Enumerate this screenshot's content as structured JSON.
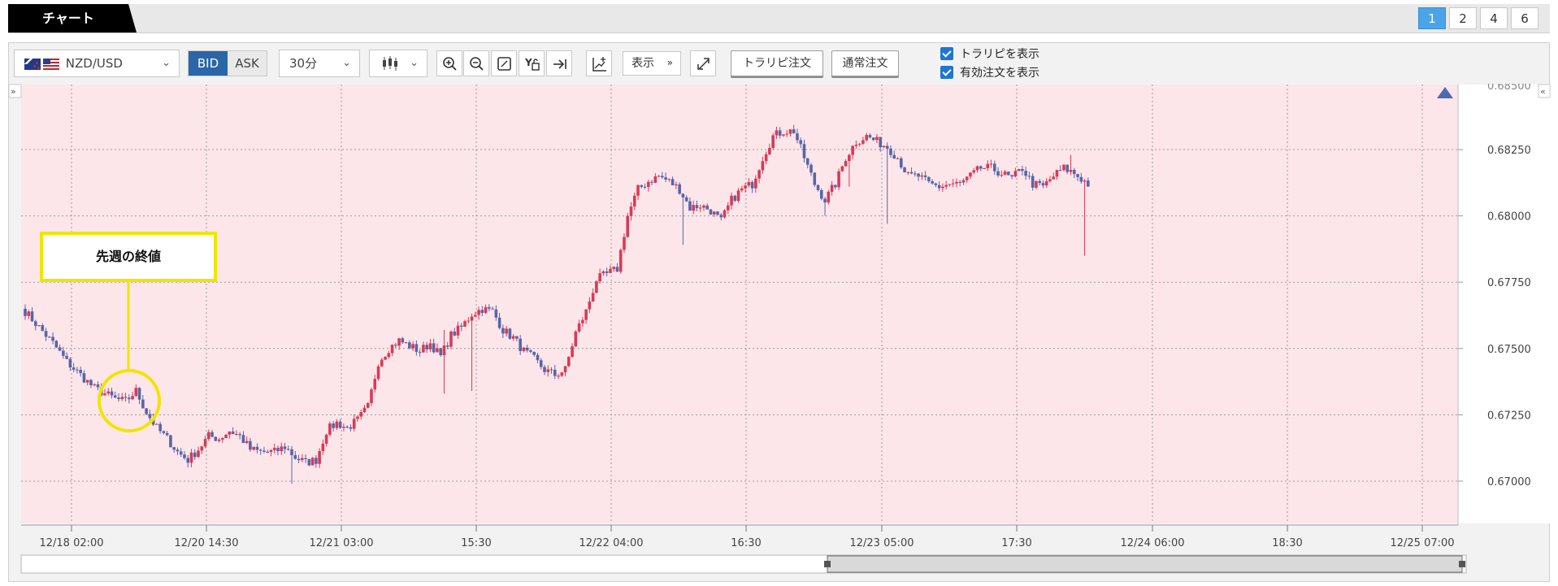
{
  "tab": {
    "title": "チャート"
  },
  "layout_buttons": [
    "1",
    "2",
    "4",
    "6"
  ],
  "toolbar": {
    "symbol": "NZD/USD",
    "bid_label": "BID",
    "ask_label": "ASK",
    "interval": "30分",
    "display_label": "表示",
    "trail_order_label": "トラリピ注文",
    "normal_order_label": "通常注文",
    "checkbox_trail": "トラリピを表示",
    "checkbox_orders": "有効注文を表示"
  },
  "annotation": {
    "label": "先週の終値"
  },
  "colors": {
    "up": "#d83a55",
    "down": "#5865aa",
    "plot_bg": "#fde6ea",
    "annotation": "#f2e400",
    "active": "#4aa4e8"
  },
  "chart_data": {
    "type": "candlestick",
    "symbol": "NZD/USD",
    "interval": "30分",
    "y_ticks": [
      0.67,
      0.6725,
      0.675,
      0.6775,
      0.68,
      0.6825
    ],
    "y_tick_labels": [
      "0.67000",
      "0.67250",
      "0.67500",
      "0.67750",
      "0.68000",
      "0.68250"
    ],
    "x_tick_labels": [
      "12/18 02:00",
      "12/20 14:30",
      "12/21 03:00",
      "15:30",
      "12/22 04:00",
      "16:30",
      "12/23 05:00",
      "17:30",
      "12/24 06:00",
      "18:30",
      "12/25 07:00"
    ],
    "ylim": [
      0.6689,
      0.685
    ],
    "close_keypoints": [
      [
        0,
        0.6764
      ],
      [
        4,
        0.6758
      ],
      [
        8,
        0.6752
      ],
      [
        12,
        0.6745
      ],
      [
        16,
        0.674
      ],
      [
        20,
        0.6735
      ],
      [
        23,
        0.6733
      ],
      [
        26,
        0.6731
      ],
      [
        29,
        0.673
      ],
      [
        32,
        0.6734
      ],
      [
        35,
        0.6726
      ],
      [
        38,
        0.672
      ],
      [
        41,
        0.6716
      ],
      [
        44,
        0.6711
      ],
      [
        47,
        0.6708
      ],
      [
        50,
        0.6712
      ],
      [
        53,
        0.6717
      ],
      [
        56,
        0.6716
      ],
      [
        59,
        0.6719
      ],
      [
        62,
        0.6717
      ],
      [
        65,
        0.6712
      ],
      [
        68,
        0.6711
      ],
      [
        72,
        0.6711
      ],
      [
        75,
        0.6713
      ],
      [
        78,
        0.6709
      ],
      [
        81,
        0.6707
      ],
      [
        84,
        0.6708
      ],
      [
        87,
        0.6719
      ],
      [
        90,
        0.6722
      ],
      [
        93,
        0.672
      ],
      [
        96,
        0.6723
      ],
      [
        99,
        0.6728
      ],
      [
        102,
        0.6745
      ],
      [
        105,
        0.675
      ],
      [
        108,
        0.6753
      ],
      [
        111,
        0.6751
      ],
      [
        114,
        0.6749
      ],
      [
        117,
        0.6752
      ],
      [
        120,
        0.6747
      ],
      [
        123,
        0.6755
      ],
      [
        126,
        0.6758
      ],
      [
        129,
        0.6763
      ],
      [
        132,
        0.6765
      ],
      [
        135,
        0.6764
      ],
      [
        138,
        0.6757
      ],
      [
        141,
        0.6754
      ],
      [
        144,
        0.6749
      ],
      [
        147,
        0.6746
      ],
      [
        150,
        0.6742
      ],
      [
        153,
        0.674
      ],
      [
        156,
        0.6742
      ],
      [
        159,
        0.6756
      ],
      [
        162,
        0.6764
      ],
      [
        165,
        0.6776
      ],
      [
        168,
        0.6778
      ],
      [
        171,
        0.678
      ],
      [
        174,
        0.68
      ],
      [
        177,
        0.681
      ],
      [
        180,
        0.6813
      ],
      [
        183,
        0.6815
      ],
      [
        186,
        0.6813
      ],
      [
        189,
        0.681
      ],
      [
        192,
        0.6803
      ],
      [
        195,
        0.6804
      ],
      [
        198,
        0.6802
      ],
      [
        201,
        0.6798
      ],
      [
        204,
        0.6806
      ],
      [
        207,
        0.681
      ],
      [
        210,
        0.6812
      ],
      [
        213,
        0.6822
      ],
      [
        216,
        0.683
      ],
      [
        219,
        0.6832
      ],
      [
        222,
        0.6832
      ],
      [
        225,
        0.6822
      ],
      [
        228,
        0.6812
      ],
      [
        231,
        0.6806
      ],
      [
        234,
        0.6812
      ],
      [
        237,
        0.6822
      ],
      [
        240,
        0.6828
      ],
      [
        243,
        0.683
      ],
      [
        246,
        0.6828
      ],
      [
        249,
        0.6826
      ],
      [
        252,
        0.6822
      ],
      [
        255,
        0.6815
      ],
      [
        258,
        0.6815
      ],
      [
        261,
        0.6812
      ],
      [
        264,
        0.6811
      ],
      [
        267,
        0.6812
      ],
      [
        270,
        0.6812
      ],
      [
        273,
        0.6815
      ],
      [
        276,
        0.6818
      ],
      [
        279,
        0.6818
      ],
      [
        282,
        0.6816
      ],
      [
        285,
        0.6814
      ],
      [
        288,
        0.6818
      ],
      [
        291,
        0.6812
      ],
      [
        294,
        0.6811
      ],
      [
        297,
        0.6815
      ],
      [
        300,
        0.6818
      ],
      [
        303,
        0.6816
      ],
      [
        306,
        0.6813
      ],
      [
        307,
        0.6812
      ]
    ],
    "wick_spikes": [
      {
        "index": 77,
        "low": 0.6699
      },
      {
        "index": 121,
        "high": 0.6757,
        "low": 0.6733
      },
      {
        "index": 129,
        "low": 0.6734
      },
      {
        "index": 190,
        "low": 0.6789
      },
      {
        "index": 231,
        "low": 0.68
      },
      {
        "index": 238,
        "low": 0.6811
      },
      {
        "index": 249,
        "low": 0.6797
      },
      {
        "index": 302,
        "high": 0.6823
      },
      {
        "index": 306,
        "low": 0.6785
      }
    ]
  }
}
